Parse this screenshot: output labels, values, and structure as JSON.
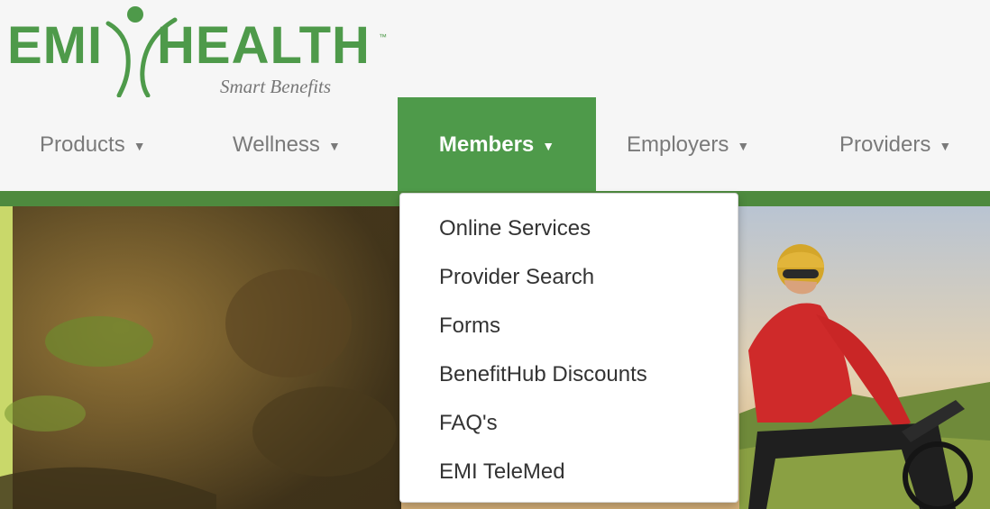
{
  "brand": {
    "name_left": "EMI",
    "name_right": "HEALTH",
    "trademark": "™",
    "tagline": "Smart Benefits",
    "color": "#4e9a4a"
  },
  "nav": {
    "items": [
      {
        "label": "Products",
        "active": false
      },
      {
        "label": "Wellness",
        "active": false
      },
      {
        "label": "Members",
        "active": true
      },
      {
        "label": "Employers",
        "active": false
      },
      {
        "label": "Providers",
        "active": false
      }
    ],
    "caret_icon": "caret-down-icon"
  },
  "members_menu": {
    "items": [
      "Online Services",
      "Provider Search",
      "Forms",
      "BenefitHub Discounts",
      "FAQ's",
      "EMI TeleMed"
    ]
  },
  "colors": {
    "accent": "#4e9a4a",
    "bar": "#4e8a3e",
    "nav_text": "#7a7a7a"
  }
}
